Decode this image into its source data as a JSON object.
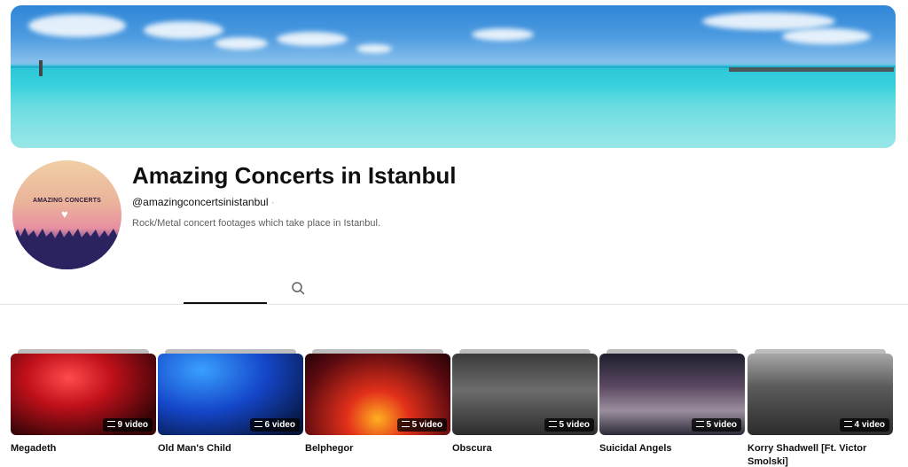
{
  "channel": {
    "name": "Amazing Concerts in Istanbul",
    "handle": "@amazingconcertsinistanbul",
    "handle_separator": "·",
    "description": "Rock/Metal concert footages which take place in Istanbul.",
    "avatar_text": "AMAZING CONCERTS"
  },
  "tabs": {
    "search_icon": "search-icon"
  },
  "playlists": [
    {
      "title": "Megadeth",
      "count": "9 video"
    },
    {
      "title": "Old Man's Child",
      "count": "6 video"
    },
    {
      "title": "Belphegor",
      "count": "5 video"
    },
    {
      "title": "Obscura",
      "count": "5 video"
    },
    {
      "title": "Suicidal Angels",
      "count": "5 video"
    },
    {
      "title": "Korry Shadwell [Ft. Victor Smolski]",
      "count": "4 video"
    }
  ]
}
